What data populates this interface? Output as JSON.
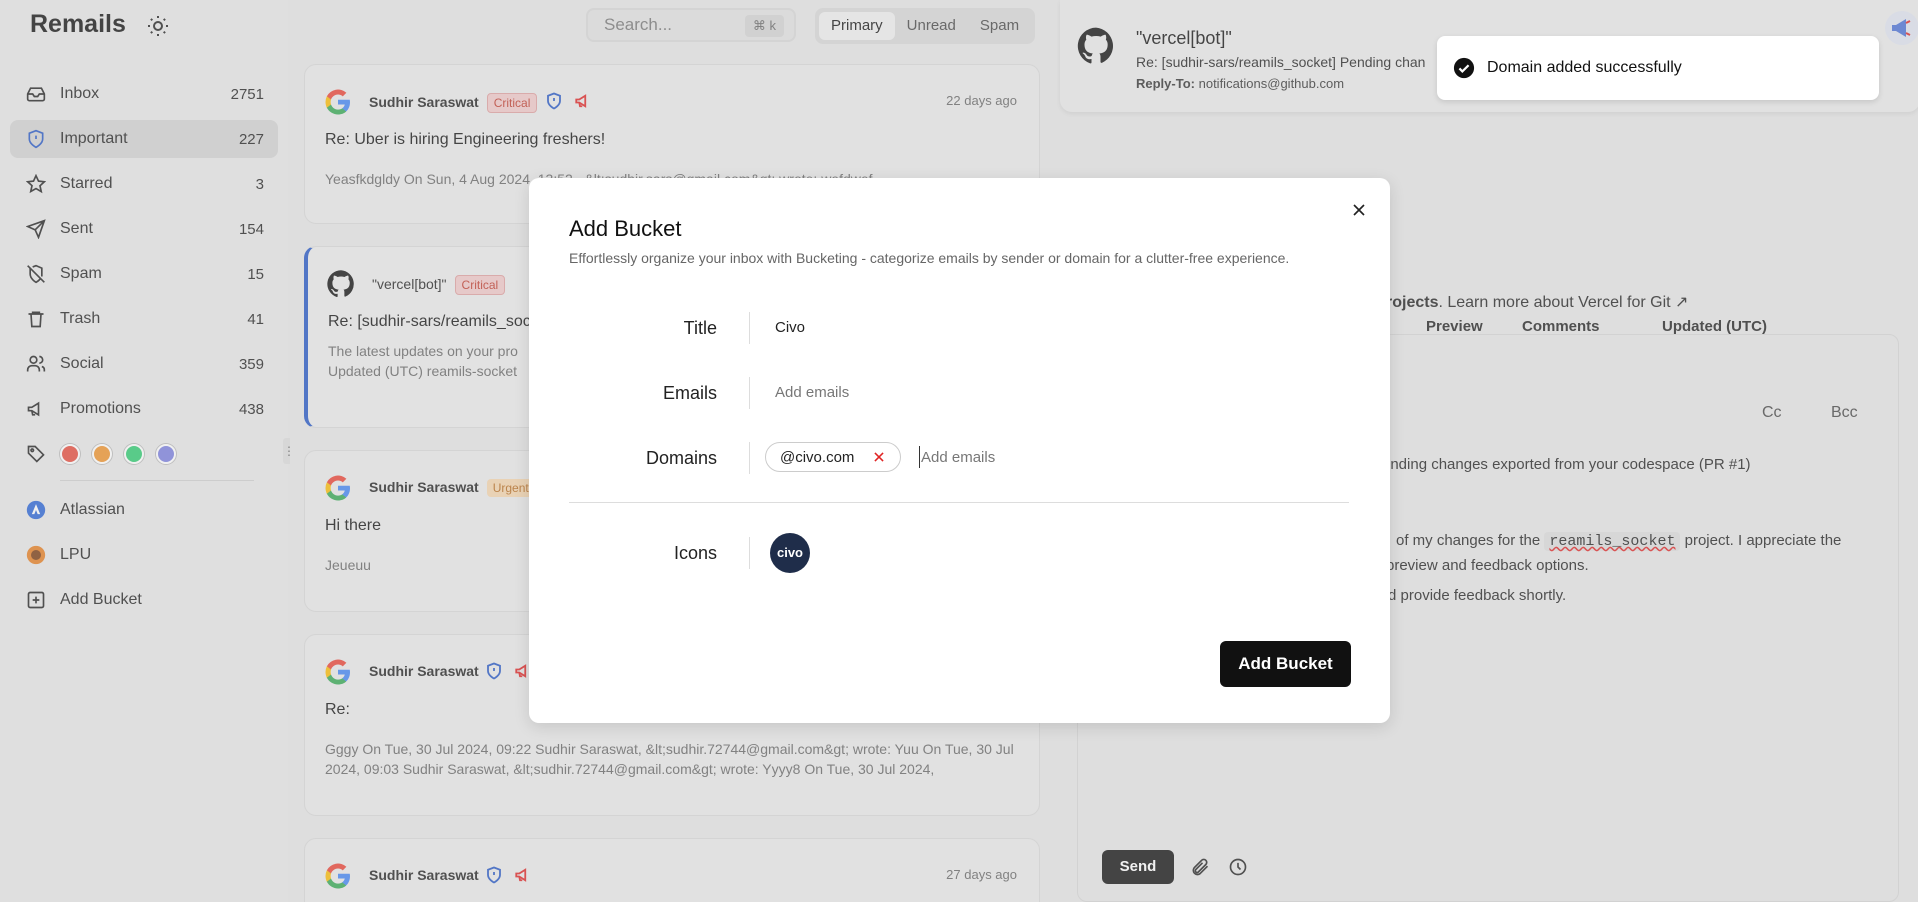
{
  "app": {
    "title": "Remails"
  },
  "sidebar": {
    "items": [
      {
        "label": "Inbox",
        "count": "2751"
      },
      {
        "label": "Important",
        "count": "227"
      },
      {
        "label": "Starred",
        "count": "3"
      },
      {
        "label": "Sent",
        "count": "154"
      },
      {
        "label": "Spam",
        "count": "15"
      },
      {
        "label": "Trash",
        "count": "41"
      },
      {
        "label": "Social",
        "count": "359"
      },
      {
        "label": "Promotions",
        "count": "438"
      }
    ],
    "tag_colors": [
      "#e74c3c",
      "#f0932b",
      "#2ecc71",
      "#7b7fe0"
    ],
    "buckets": [
      {
        "label": "Atlassian"
      },
      {
        "label": "LPU"
      }
    ],
    "add_bucket": "Add Bucket"
  },
  "search": {
    "placeholder": "Search...",
    "shortcut": "⌘  k"
  },
  "tabs": [
    {
      "label": "Primary"
    },
    {
      "label": "Unread"
    },
    {
      "label": "Spam"
    }
  ],
  "emails": [
    {
      "from": "Sudhir Saraswat",
      "badge": "Critical",
      "time": "22 days ago",
      "subject": "Re: Uber is hiring Engineering freshers!",
      "preview": "Yeasfkdgldy On Sun, 4 Aug 2024, 13:52 , &lt;sudhir.sars@gmail.com&gt; wrote: wefdwef"
    },
    {
      "from": "\"vercel[bot]\"",
      "badge": "Critical",
      "subject": "Re: [sudhir-sars/reamils_sock",
      "preview1": "The latest updates on your pro",
      "preview2": "Updated (UTC) reamils-socket"
    },
    {
      "from": "Sudhir Saraswat",
      "badge": "Urgent",
      "subject": "Hi there",
      "preview": "Jeueuu"
    },
    {
      "from": "Sudhir Saraswat",
      "subject": "Re:",
      "preview": "Gggy On Tue, 30 Jul 2024, 09:22 Sudhir Saraswat, &lt;sudhir.72744@gmail.com&gt; wrote: Yuu On Tue, 30 Jul 2024, 09:03 Sudhir Saraswat, &lt;sudhir.72744@gmail.com&gt; wrote: Yyyy8 On Tue, 30 Jul 2024,"
    },
    {
      "from": "Sudhir Saraswat",
      "time": "27 days ago"
    }
  ],
  "reader": {
    "from": "\"vercel[bot]\"",
    "subject": "Re: [sudhir-sars/reamils_socket] Pending chan",
    "reply_to_label": "Reply-To:",
    "reply_to": "notifications@github.com",
    "line_projects": "rojects",
    "line_learn": ". Learn more about Vercel for Git ↗",
    "col_preview": "Preview",
    "col_comments": "Comments",
    "col_updated": "Updated (UTC)",
    "cc": "Cc",
    "bcc": "Bcc",
    "s_frag": "s",
    "compose_line1": "ending changes exported from your codespace (PR #1)",
    "compose_line2a": "of my changes for the",
    "compose_code": "reamils_socket",
    "compose_line2b": "project. I appreciate the",
    "compose_line3": "preview and feedback options.",
    "compose_line4": "d provide feedback shortly.",
    "send": "Send"
  },
  "toast": {
    "message": "Domain added successfully"
  },
  "modal": {
    "title": "Add Bucket",
    "description": "Effortlessly organize your inbox with Bucketing - categorize emails by sender or domain for a clutter-free experience.",
    "title_label": "Title",
    "title_value": "Civo",
    "emails_label": "Emails",
    "emails_placeholder": "Add emails",
    "domains_label": "Domains",
    "domain_chip": "@civo.com",
    "domains_placeholder": "Add emails",
    "icons_label": "Icons",
    "icon_text": "civo",
    "submit": "Add Bucket"
  }
}
